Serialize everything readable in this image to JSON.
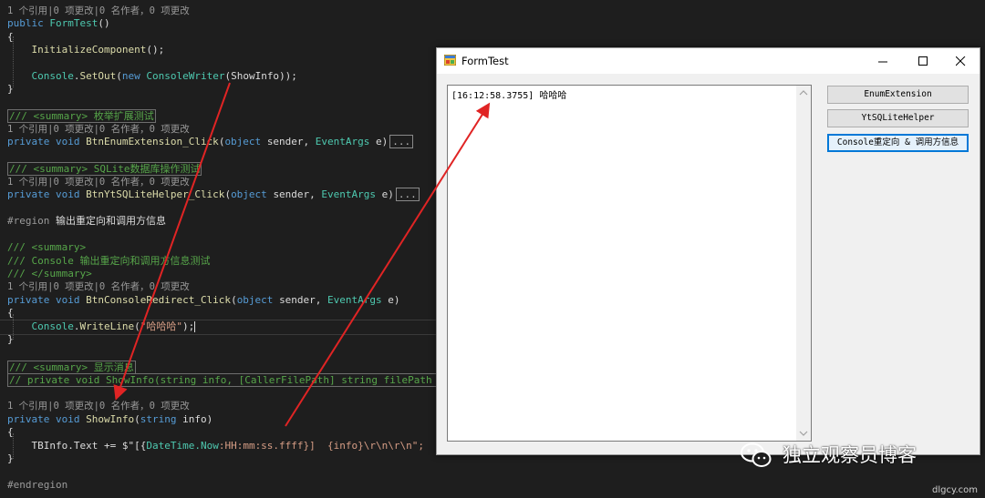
{
  "code": {
    "lens1": "1 个引用|0 项更改|0 名作者，0 项更改",
    "l_ctor_kw": "public",
    "l_ctor_name": "FormTest",
    "l_ctor_paren": "()",
    "brace_open": "{",
    "brace_close": "}",
    "l_init": "InitializeComponent",
    "l_init_tail": "();",
    "l_console": "Console",
    "l_setout": "SetOut",
    "l_new": "new",
    "l_writer": "ConsoleWriter",
    "l_showinfo_arg": "ShowInfo",
    "l_setout_tail": "));",
    "summary_enum": "/// <summary> 枚举扩展测试",
    "lens2": "1 个引用|0 项更改|0 名作者，0 项更改",
    "l_private": "private",
    "l_void": "void",
    "m_enum": "BtnEnumExtension_Click",
    "p_object": "object",
    "p_sender": "sender,",
    "p_eventargs": "EventArgs",
    "p_e": "e)",
    "dots": "...",
    "summary_sqlite": "/// <summary> SQLite数据库操作测试",
    "lens3": "1 个引用|0 项更改|0 名作者，0 项更改",
    "m_sqlite": "BtnYtSQLiteHelper_Click",
    "region_kw": "#region",
    "region_text": "输出重定向和调用方信息",
    "doc1": "/// <summary>",
    "doc2": "/// Console 输出重定向和调用方信息测试",
    "doc3": "/// </summary>",
    "lens4": "1 个引用|0 项更改|0 名作者，0 项更改",
    "m_redirect": "BtnConsoleRedirect_Click",
    "l_writeline": "WriteLine",
    "l_str": "\"哈哈哈\"",
    "l_writeline_tail": ");",
    "summary_show": "/// <summary> 显示消息",
    "collapsed_sig": "// private void ShowInfo(string info, [CallerFilePath] string filePath =",
    "lens5": "1 个引用|0 项更改|0 名作者，0 项更改",
    "m_showinfo": "ShowInfo",
    "p_string": "string",
    "p_info": "info)",
    "l_tbinfo": "TBInfo.Text += $\"[{",
    "l_datetime": "DateTime.Now",
    "l_fmt": ":HH:mm:ss.ffff",
    "l_tail": "}]  {info}\\r\\n\\r\\n\";",
    "endregion": "#endregion"
  },
  "window": {
    "title": "FormTest",
    "minimize": "minimize",
    "maximize": "maximize",
    "close": "close",
    "textbox_content": "[16:12:58.3755] 哈哈哈",
    "buttons": [
      {
        "label": "EnumExtension"
      },
      {
        "label": "YtSQLiteHelper"
      },
      {
        "label": "Console重定向 & 调用方信息"
      }
    ]
  },
  "watermark": {
    "text": "独立观察员博客",
    "url": "dlgcy.com"
  },
  "colors": {
    "keyword": "#569cd6",
    "type": "#4ec9b0",
    "method": "#dcdcaa",
    "comment": "#57a64a",
    "string": "#d69d85",
    "arrow": "#e02424",
    "focus": "#0078d7"
  }
}
